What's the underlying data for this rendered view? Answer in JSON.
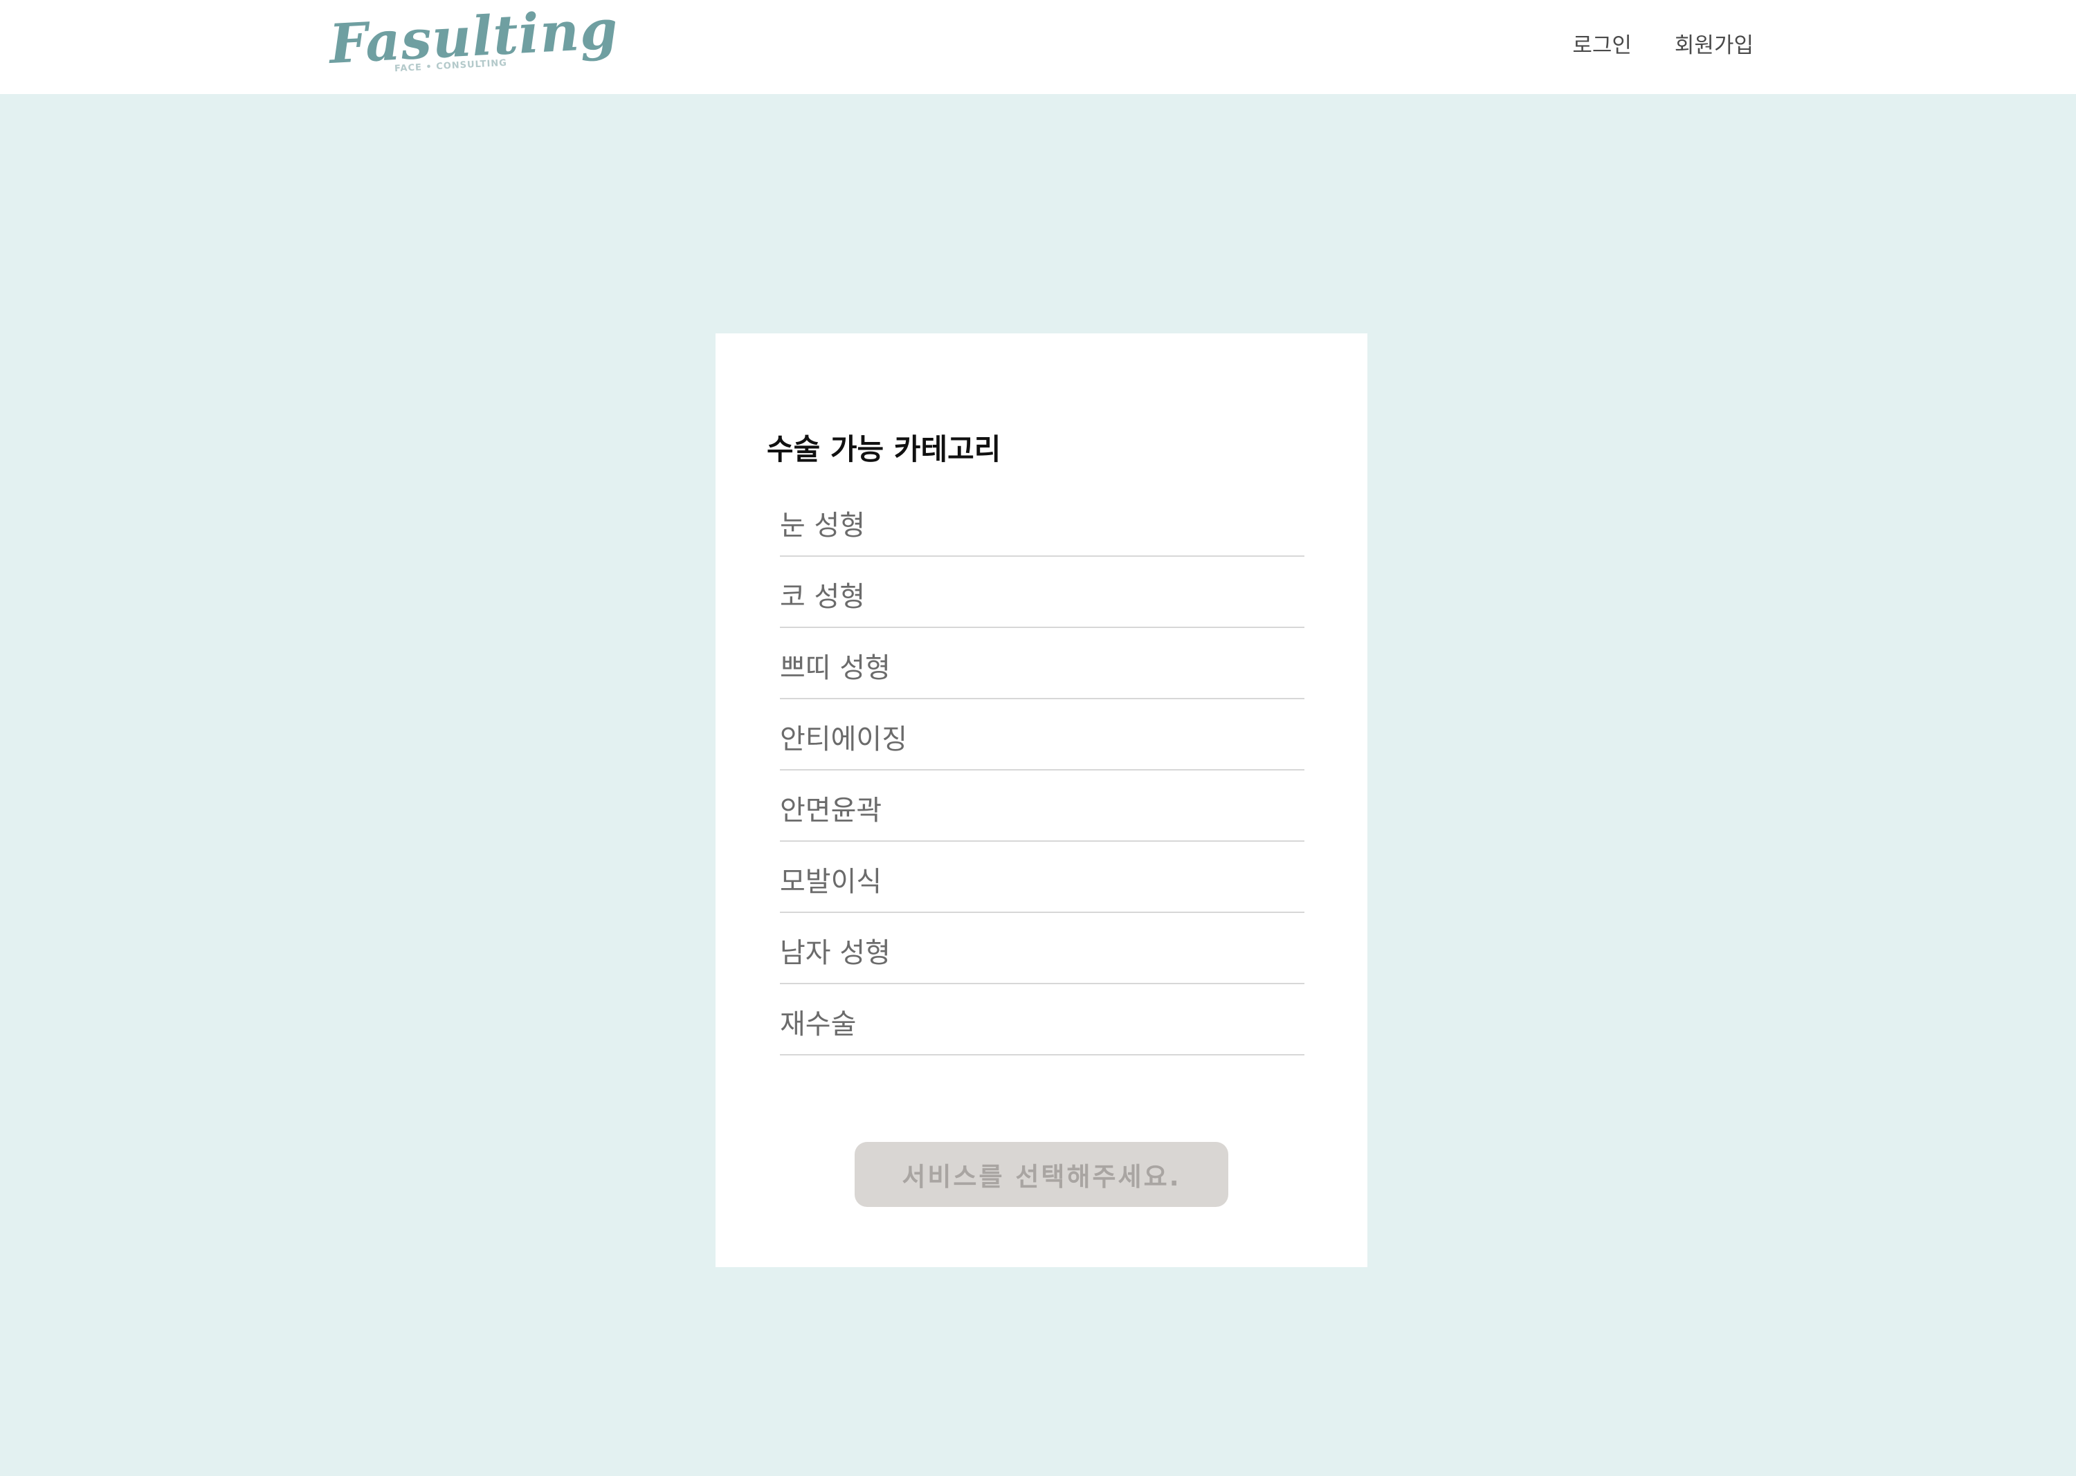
{
  "header": {
    "logo_text": "Fasulting",
    "logo_subtext": "FACE • CONSULTING",
    "nav": {
      "login_label": "로그인",
      "signup_label": "회원가입"
    }
  },
  "colors": {
    "page_background": "#e3f1f1",
    "logo_teal": "#6f9fa1",
    "button_disabled_bg": "#d9d6d3",
    "button_disabled_text": "#a9a5a2"
  },
  "card": {
    "title": "수술 가능 카테고리",
    "categories": [
      {
        "label": "눈 성형"
      },
      {
        "label": "코 성형"
      },
      {
        "label": "쁘띠 성형"
      },
      {
        "label": "안티에이징"
      },
      {
        "label": "안면윤곽"
      },
      {
        "label": "모발이식"
      },
      {
        "label": "남자 성형"
      },
      {
        "label": "재수술"
      }
    ],
    "submit_label": "서비스를 선택해주세요."
  }
}
